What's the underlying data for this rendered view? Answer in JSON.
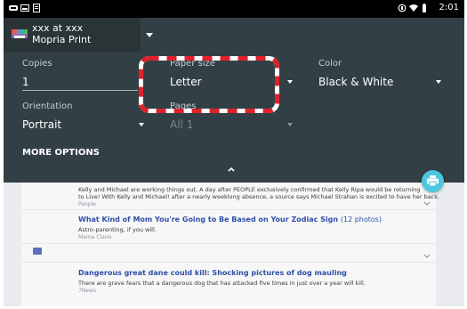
{
  "status_bar": {
    "time": "2:01"
  },
  "printer": {
    "name": "xxx at xxx",
    "service": "Mopria Print"
  },
  "settings": {
    "copies": {
      "label": "Copies",
      "value": "1"
    },
    "paper_size": {
      "label": "Paper size",
      "value": "Letter"
    },
    "color": {
      "label": "Color",
      "value": "Black & White"
    },
    "orientation": {
      "label": "Orientation",
      "value": "Portrait"
    },
    "pages": {
      "label": "Pages",
      "value": "All 1"
    },
    "more_options": "MORE OPTIONS"
  },
  "articles": [
    {
      "body_line1": "Kelly and Michael are working things out. A day after PEOPLE exclusively confirmed that Kelly Ripa would be returning",
      "body_line2": "to Live! With Kelly and Michael! after a nearly weeklong absence, a source says Michael Strahan is excited to have her back.",
      "source": "People"
    },
    {
      "title": "What Kind of Mom You're Going to Be Based on Your Zodiac Sign",
      "count": "(12 photos)",
      "snippet": "Astro-parenting, if you will.",
      "source": "Mama Claire"
    },
    {
      "title": "Dangerous great dane could kill: Shocking pictures of dog mauling",
      "snippet": "There are grave fears that a dangerous dog that has attacked five times in just over a year will kill.",
      "source": "7News"
    }
  ],
  "colors": {
    "dialog_bg": "#324046",
    "highlight_red": "#e0202a",
    "link_blue": "#2f4fa8",
    "fab_cyan": "#4ec6e0"
  },
  "icons": {
    "printer": "printer-icon",
    "fab": "print-icon",
    "collapse": "chevron-up-icon"
  }
}
